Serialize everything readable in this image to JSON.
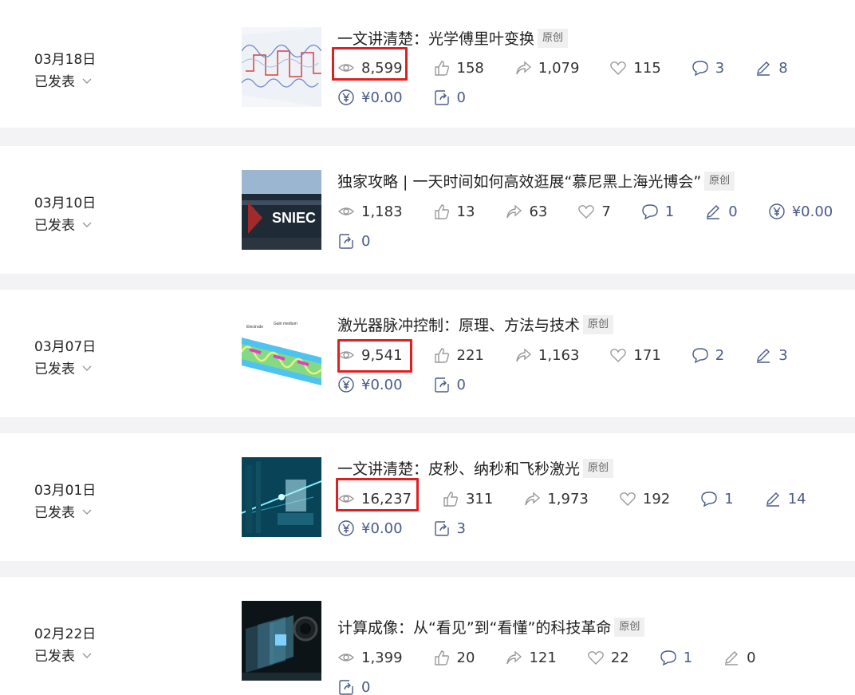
{
  "articles": [
    {
      "date": "03月18日",
      "status": "已发表",
      "title": "一文讲清楚：光学傅里叶变换",
      "badge": "原创",
      "views": "8,599",
      "likes": "158",
      "shares": "1,079",
      "favorites": "115",
      "comments": "3",
      "edits": "8",
      "reward": "¥0.00",
      "reposts": "0",
      "views_highlighted": true
    },
    {
      "date": "03月10日",
      "status": "已发表",
      "title": "独家攻略 | 一天时间如何高效逛展“慕尼黑上海光博会”",
      "badge": "原创",
      "views": "1,183",
      "likes": "13",
      "shares": "63",
      "favorites": "7",
      "comments": "1",
      "edits": "0",
      "reward": "¥0.00",
      "reposts": "0",
      "thumb_text": "SNIEC",
      "views_highlighted": false
    },
    {
      "date": "03月07日",
      "status": "已发表",
      "title": "激光器脉冲控制：原理、方法与技术",
      "badge": "原创",
      "views": "9,541",
      "likes": "221",
      "shares": "1,163",
      "favorites": "171",
      "comments": "2",
      "edits": "3",
      "reward": "¥0.00",
      "reposts": "0",
      "views_highlighted": true
    },
    {
      "date": "03月01日",
      "status": "已发表",
      "title": "一文讲清楚：皮秒、纳秒和飞秒激光",
      "badge": "原创",
      "views": "16,237",
      "likes": "311",
      "shares": "1,973",
      "favorites": "192",
      "comments": "1",
      "edits": "14",
      "reward": "¥0.00",
      "reposts": "3",
      "views_highlighted": true
    },
    {
      "date": "02月22日",
      "status": "已发表",
      "title": "计算成像：从“看见”到“看懂”的科技革命",
      "badge": "原创",
      "views": "1,399",
      "likes": "20",
      "shares": "121",
      "favorites": "22",
      "comments": "1",
      "edits": "0",
      "reposts": "0",
      "views_highlighted": false
    }
  ],
  "colors": {
    "highlight": "#e02020",
    "metric_blue": "#4a5b8a",
    "icon_gray": "#999999"
  }
}
